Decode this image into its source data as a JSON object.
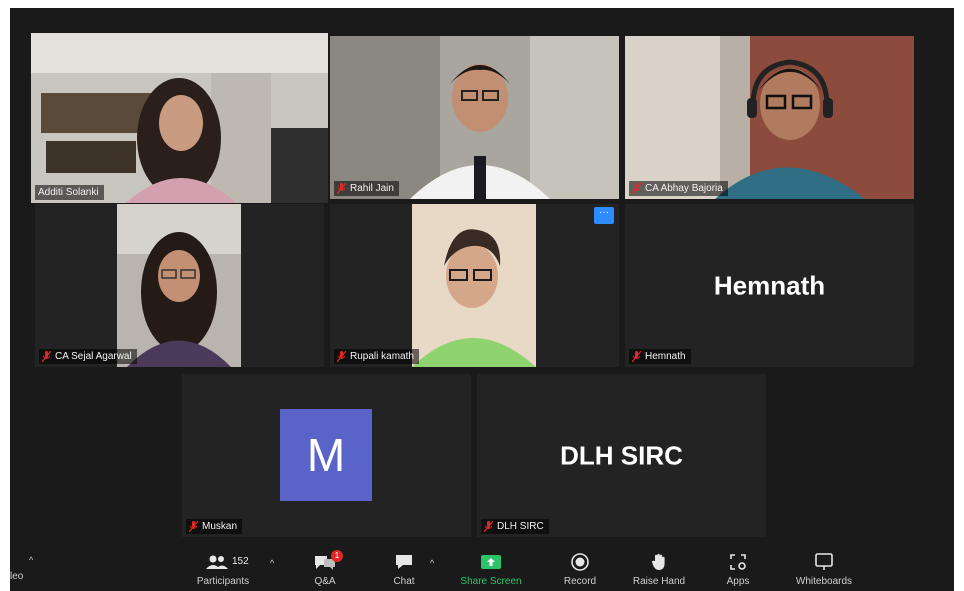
{
  "participants_grid": [
    {
      "name": "Additi Solanki",
      "active": true
    },
    {
      "name": "Rahil Jain"
    },
    {
      "name": "CA Abhay Bajoria"
    },
    {
      "name": "CA Sejal Agarwal"
    },
    {
      "name": "Rupali kamath"
    },
    {
      "name": "Hemnath",
      "display": "Hemnath"
    },
    {
      "name": "Muskan",
      "avatar_letter": "M"
    },
    {
      "name": "DLH SIRC",
      "display": "DLH SIRC"
    }
  ],
  "toolbar": {
    "left_label": "leo",
    "participants_count": "152",
    "participants_label": "Participants",
    "qa_badge": "1",
    "qa_label": "Q&A",
    "chat_label": "Chat",
    "share_label": "Share Screen",
    "record_label": "Record",
    "raise_hand_label": "Raise Hand",
    "apps_label": "Apps",
    "whiteboards_label": "Whiteboards"
  },
  "colors": {
    "active_speaker_border": "#d9e96a",
    "share_green": "#2cc36b",
    "avatar_purple": "#5a63c8",
    "more_blue": "#2d8cff",
    "badge_red": "#e02828"
  },
  "icons": [
    "mic-muted-icon",
    "participants-icon",
    "qa-icon",
    "chat-icon",
    "share-screen-icon",
    "record-icon",
    "raise-hand-icon",
    "apps-icon",
    "whiteboard-icon",
    "caret-up-icon",
    "more-options-icon"
  ]
}
